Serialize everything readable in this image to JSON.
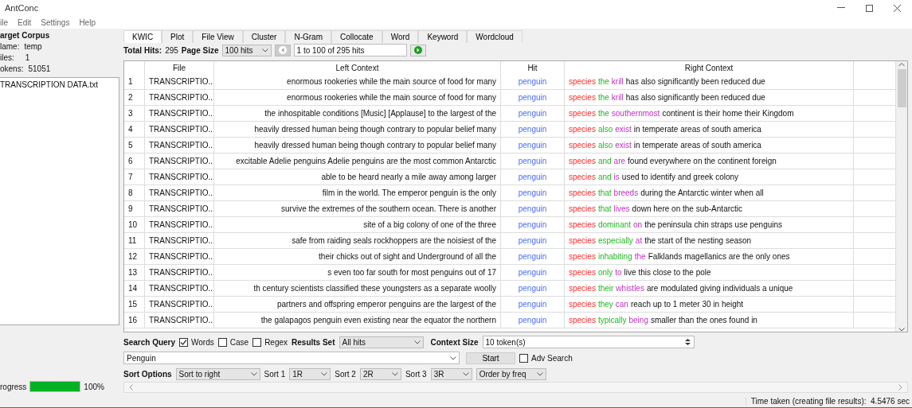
{
  "window": {
    "title": "AntConc"
  },
  "menu": [
    "ile",
    "Edit",
    "Settings",
    "Help"
  ],
  "corpus": {
    "heading": "arget Corpus",
    "name_label": "lame:",
    "name": "temp",
    "files_label": "iles:",
    "files": "1",
    "tokens_label": "okens:",
    "tokens": "51051",
    "file_list": [
      "TRANSCRIPTION DATA.txt"
    ]
  },
  "progress": {
    "label": "rogress",
    "level": 1,
    "reading": "100%"
  },
  "tabs": [
    {
      "label": "KWIC",
      "selected": true
    },
    {
      "label": "Plot",
      "selected": false
    },
    {
      "label": "File View",
      "selected": false
    },
    {
      "label": "Cluster",
      "selected": false
    },
    {
      "label": "N-Gram",
      "selected": false
    },
    {
      "label": "Collocate",
      "selected": false
    },
    {
      "label": "Word",
      "selected": false
    },
    {
      "label": "Keyword",
      "selected": false
    },
    {
      "label": "Wordcloud",
      "selected": false
    }
  ],
  "hits_bar": {
    "total_label": "Total Hits:",
    "total": "295",
    "page_size_label": "Page Size",
    "page_size": "100 hits",
    "range": "1 to 100 of 295 hits"
  },
  "table": {
    "columns": [
      "File",
      "Left Context",
      "Hit",
      "Right Context"
    ],
    "rows": [
      {
        "number": "1",
        "file": "TRANSCRIPTIO...",
        "left": "enormous rookeries while the main source of food for many",
        "hit": "penguin",
        "right": [
          "species",
          "the",
          "krill",
          "has also significantly been reduced due"
        ]
      },
      {
        "number": "2",
        "file": "TRANSCRIPTIO...",
        "left": "enormous rookeries while the main source of food for many",
        "hit": "penguin",
        "right": [
          "species",
          "the",
          "krill",
          "has also significantly been reduced due"
        ]
      },
      {
        "number": "3",
        "file": "TRANSCRIPTIO...",
        "left": "the inhospitable conditions [Music] [Applause] to the largest of the",
        "hit": "penguin",
        "right": [
          "species",
          "the",
          "southernmost",
          "continent is their home their Kingdom"
        ]
      },
      {
        "number": "4",
        "file": "TRANSCRIPTIO...",
        "left": "heavily dressed human being though contrary to popular belief many",
        "hit": "penguin",
        "right": [
          "species",
          "also",
          "exist",
          "in temperate areas of south america"
        ]
      },
      {
        "number": "5",
        "file": "TRANSCRIPTIO...",
        "left": "heavily dressed human being though contrary to popular belief many",
        "hit": "penguin",
        "right": [
          "species",
          "also",
          "exist",
          "in temperate areas of south america"
        ]
      },
      {
        "number": "6",
        "file": "TRANSCRIPTIO...",
        "left": "excitable Adelie penguins Adelie penguins are the most common Antarctic",
        "hit": "penguin",
        "right": [
          "species",
          "and",
          "are",
          "found everywhere on the continent foreign"
        ]
      },
      {
        "number": "7",
        "file": "TRANSCRIPTIO...",
        "left": "able to be heard nearly a mile away among larger",
        "hit": "penguin",
        "right": [
          "species",
          "and",
          "is",
          "used to identify and greek colony"
        ]
      },
      {
        "number": "8",
        "file": "TRANSCRIPTIO...",
        "left": "film in the world. The emperor penguin is the only",
        "hit": "penguin",
        "right": [
          "species",
          "that",
          "breeds",
          "during the Antarctic winter when all"
        ]
      },
      {
        "number": "9",
        "file": "TRANSCRIPTIO...",
        "left": "survive the extremes of the southern ocean. There is another",
        "hit": "penguin",
        "right": [
          "species",
          "that",
          "lives",
          "down here on the sub-Antarctic"
        ]
      },
      {
        "number": "10",
        "file": "TRANSCRIPTIO...",
        "left": "site of a big colony of one of the three",
        "hit": "penguin",
        "right": [
          "species",
          "dominant",
          "on",
          "the peninsula chin straps use penguins"
        ]
      },
      {
        "number": "11",
        "file": "TRANSCRIPTIO...",
        "left": "safe from raiding seals rockhoppers are the noisiest of the",
        "hit": "penguin",
        "right": [
          "species",
          "especially",
          "at",
          "the start of the nesting season"
        ]
      },
      {
        "number": "12",
        "file": "TRANSCRIPTIO...",
        "left": "their chicks out of sight and Underground of all the",
        "hit": "penguin",
        "right": [
          "species",
          "inhabiting",
          "the",
          "Falklands magellanics are the only ones"
        ]
      },
      {
        "number": "13",
        "file": "TRANSCRIPTIO...",
        "left": "s even too far south for most penguins out of 17",
        "hit": "penguin",
        "right": [
          "species",
          "only",
          "to",
          "live this close to the pole"
        ]
      },
      {
        "number": "14",
        "file": "TRANSCRIPTIO...",
        "left": "th century scientists classified these youngsters as a separate woolly",
        "hit": "penguin",
        "right": [
          "species",
          "their",
          "whistles",
          "are modulated giving individuals a unique"
        ]
      },
      {
        "number": "15",
        "file": "TRANSCRIPTIO...",
        "left": "partners and offspring emperor penguins are the largest of the",
        "hit": "penguin",
        "right": [
          "species",
          "they",
          "can",
          "reach up to 1 meter 30 in height"
        ]
      },
      {
        "number": "16",
        "file": "TRANSCRIPTIO...",
        "left": "the galapagos penguin even existing near the equator the northern",
        "hit": "penguin",
        "right": [
          "species",
          "typically",
          "being",
          "smaller than the ones found in"
        ]
      }
    ]
  },
  "search": {
    "query_label": "Search Query",
    "options": [
      {
        "label": "Words",
        "checked": true
      },
      {
        "label": "Case",
        "checked": false
      },
      {
        "label": "Regex",
        "checked": false
      }
    ],
    "results_label": "Results Set",
    "results": "All hits",
    "context_label": "Context Size",
    "context": "10 token(s)",
    "query": "Penguin",
    "start": "Start",
    "adv": {
      "label": "Adv Search",
      "checked": false
    }
  },
  "sort": {
    "label": "Sort Options",
    "mode": "Sort to right",
    "levels": [
      {
        "label": "Sort 1",
        "value": "1R"
      },
      {
        "label": "Sort 2",
        "value": "2R"
      },
      {
        "label": "Sort 3",
        "value": "3R"
      }
    ],
    "order": "Order by freq"
  },
  "status_bar": "Time taken (creating file results):  4.5476 sec"
}
